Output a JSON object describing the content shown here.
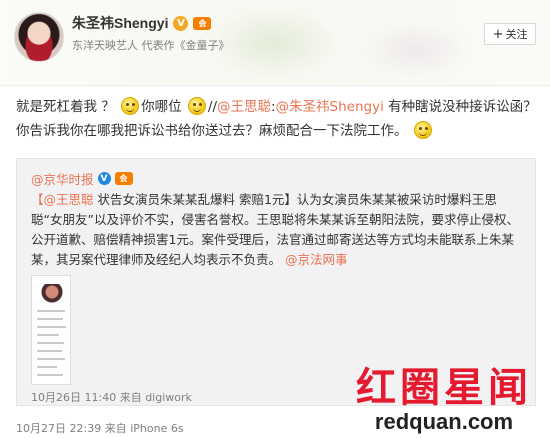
{
  "header": {
    "user_name": "朱圣祎Shengyi",
    "verified_badge": "V",
    "vip_badge": "会",
    "description": "东洋天映艺人 代表作《金童子》",
    "follow_label": "关注",
    "follow_icon": "plus-icon"
  },
  "post": {
    "text_part1": "就是死杠着我 ？",
    "text_part2": "你哪位",
    "text_part3": "//",
    "mention1": "@王思聪",
    "text_part4": ":",
    "mention2": "@朱圣祎Shengyi",
    "text_part5": " 有种瞎说没种接诉讼函？你告诉我你在哪我把诉讼书给你送过去？麻烦配合一下法院工作。",
    "time": "10月27日 22:39",
    "source_prefix": "来自",
    "source": "iPhone 6s"
  },
  "repost": {
    "user_name": "@京华时报",
    "verified_badge": "V",
    "vip_badge": "会",
    "mention1": "【@王思聪",
    "text_part1": " 状告女演员朱某某乱爆料 索赔1元】认为女演员朱某某被采访时爆料王思聪“女朋友”以及评价不实，侵害名誉权。王思聪将朱某某诉至朝阳法院，要求停止侵权、公开道歉、赔偿精神损害1元。案件受理后，法官通过邮寄送达等方式均未能联系上朱某某，其另案代理律师及经纪人均表示不负责。",
    "mention2": "@京法网事",
    "time": "10月26日 11:40",
    "source_prefix": "来自",
    "source": "digiwork"
  },
  "watermark": {
    "cn": "红圈星闻",
    "en": "redquan.com"
  },
  "colors": {
    "mention": "#eb7350",
    "watermark_red": "#e51a2e",
    "verified_orange": "#f5a623",
    "verified_blue": "#1f88e5"
  }
}
